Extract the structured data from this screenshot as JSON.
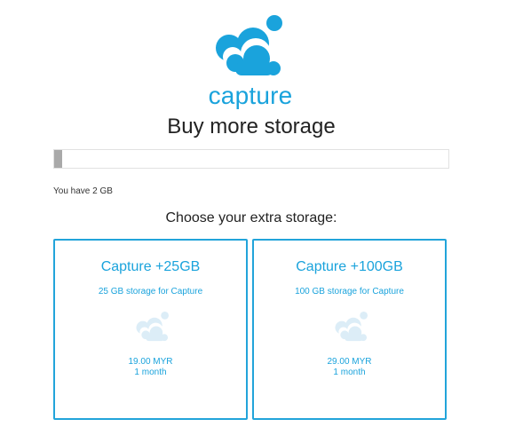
{
  "brand": {
    "name": "capture",
    "logo_icon": "cloud-icon",
    "accent_color": "#1aa3dc"
  },
  "page": {
    "title": "Buy more storage"
  },
  "storage": {
    "usage_text": "You have 2 GB",
    "used_fraction": 0.02,
    "bar_color": "#a9a9a9"
  },
  "plans": {
    "heading": "Choose your extra storage:",
    "items": [
      {
        "title": "Capture +25GB",
        "subtitle": "25 GB storage for Capture",
        "icon": "cloud-icon",
        "price": "19.00 MYR",
        "period": "1 month"
      },
      {
        "title": "Capture +100GB",
        "subtitle": "100 GB storage for Capture",
        "icon": "cloud-icon",
        "price": "29.00 MYR",
        "period": "1 month"
      }
    ]
  }
}
